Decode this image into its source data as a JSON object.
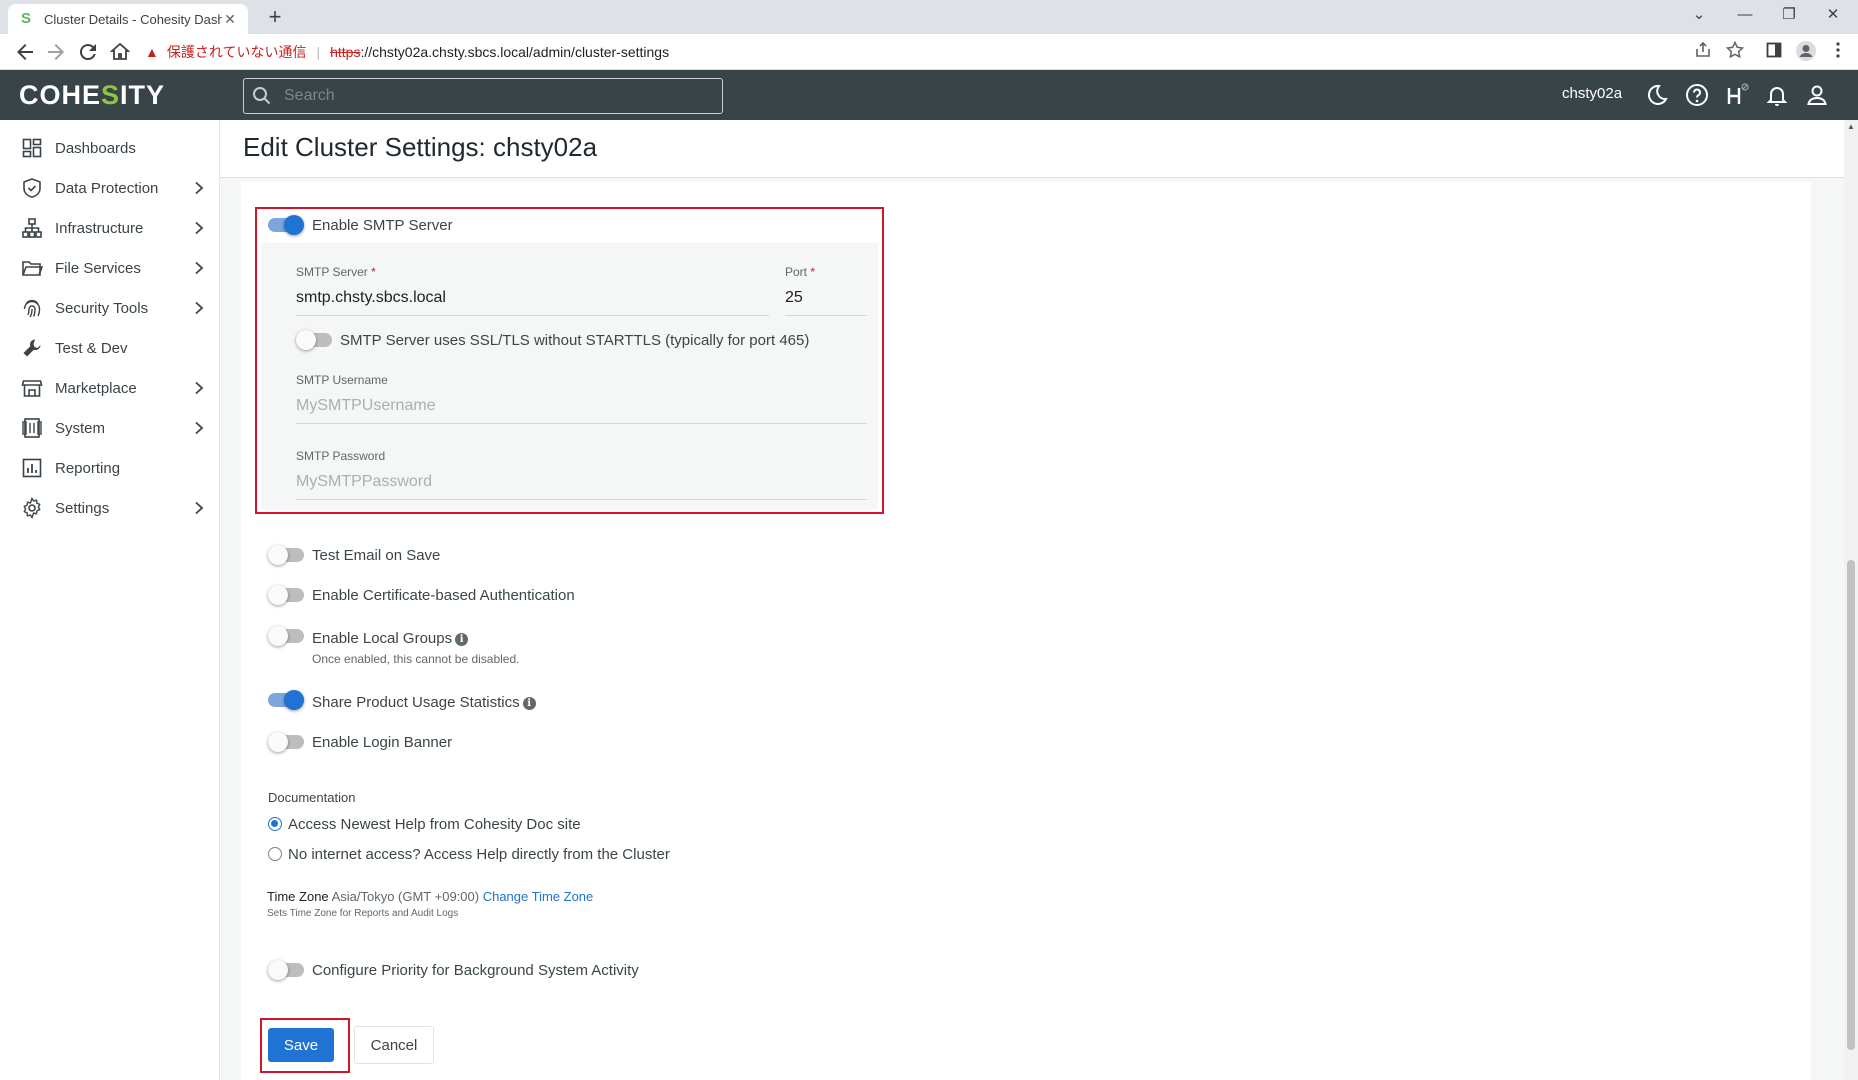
{
  "browser": {
    "tab_title": "Cluster Details - Cohesity Dashbo",
    "tab_close": "✕",
    "new_tab": "+",
    "win_minimize": "—",
    "win_restore": "❐",
    "win_close": "✕",
    "tab_list": "⌄",
    "insecure_label": "保護されていない通信",
    "url_scheme": "https",
    "url_rest": "://chsty02a.chsty.sbcs.local/admin/cluster-settings"
  },
  "header": {
    "logo_pre": "COHE",
    "logo_s": "S",
    "logo_post": "ITY",
    "search_placeholder": "Search",
    "cluster_name": "chsty02a"
  },
  "sidebar": {
    "items": [
      {
        "label": "Dashboards",
        "icon": "dashboard-icon",
        "expandable": false
      },
      {
        "label": "Data Protection",
        "icon": "shield-icon",
        "expandable": true
      },
      {
        "label": "Infrastructure",
        "icon": "hierarchy-icon",
        "expandable": true
      },
      {
        "label": "File Services",
        "icon": "folder-icon",
        "expandable": true
      },
      {
        "label": "Security Tools",
        "icon": "fingerprint-icon",
        "expandable": true
      },
      {
        "label": "Test & Dev",
        "icon": "wrench-icon",
        "expandable": false
      },
      {
        "label": "Marketplace",
        "icon": "store-icon",
        "expandable": true
      },
      {
        "label": "System",
        "icon": "server-icon",
        "expandable": true
      },
      {
        "label": "Reporting",
        "icon": "chart-icon",
        "expandable": false
      },
      {
        "label": "Settings",
        "icon": "gear-icon",
        "expandable": true
      }
    ]
  },
  "page": {
    "title": "Edit Cluster Settings: chsty02a"
  },
  "smtp": {
    "enable_label": "Enable SMTP Server",
    "enabled": true,
    "server_label": "SMTP Server",
    "server_value": "smtp.chsty.sbcs.local",
    "port_label": "Port",
    "port_value": "25",
    "required_mark": "*",
    "ssl_label": "SMTP Server uses SSL/TLS without STARTTLS (typically for port 465)",
    "ssl_enabled": false,
    "username_label": "SMTP Username",
    "username_placeholder": "MySMTPUsername",
    "password_label": "SMTP Password",
    "password_placeholder": "MySMTPPassword"
  },
  "options": {
    "test_email": {
      "label": "Test Email on Save",
      "enabled": false
    },
    "cert_auth": {
      "label": "Enable Certificate-based Authentication",
      "enabled": false
    },
    "local_groups": {
      "label": "Enable Local Groups",
      "sub": "Once enabled, this cannot be disabled.",
      "enabled": false
    },
    "usage_stats": {
      "label": "Share Product Usage Statistics",
      "enabled": true
    },
    "login_banner": {
      "label": "Enable Login Banner",
      "enabled": false
    },
    "bg_priority": {
      "label": "Configure Priority for Background System Activity",
      "enabled": false
    }
  },
  "documentation": {
    "label": "Documentation",
    "options": [
      {
        "label": "Access Newest Help from Cohesity Doc site",
        "selected": true
      },
      {
        "label": "No internet access? Access Help directly from the Cluster",
        "selected": false
      }
    ]
  },
  "timezone": {
    "key": "Time Zone",
    "value": "Asia/Tokyo (GMT +09:00)",
    "link": "Change Time Zone",
    "sub": "Sets Time Zone for Reports and Audit Logs"
  },
  "actions": {
    "save": "Save",
    "cancel": "Cancel"
  },
  "colors": {
    "primary": "#1f73d4",
    "highlight": "#d4142a",
    "header_bg": "#394449",
    "logo_accent": "#8dc63f"
  }
}
